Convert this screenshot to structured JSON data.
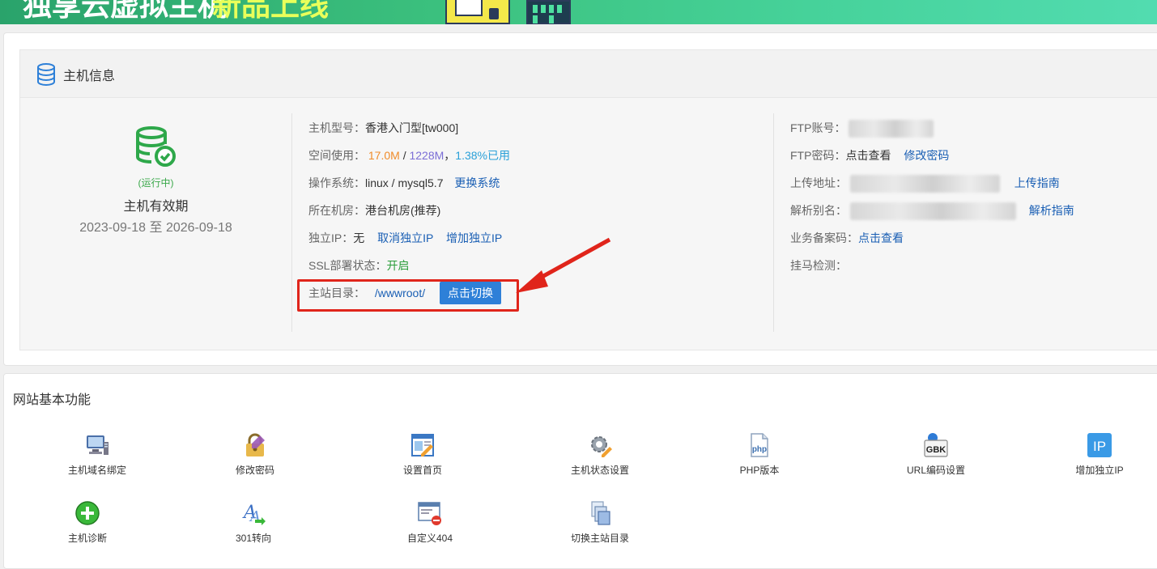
{
  "banner": {
    "title_part1": "独享云虚拟主机",
    "title_part2": "新品上线"
  },
  "host_info": {
    "title": "主机信息",
    "status": "(运行中)",
    "validity_label": "主机有效期",
    "validity_range": "2023-09-18 至 2026-09-18",
    "model_label": "主机型号：",
    "model_value": "香港入门型[tw000]",
    "space_label": "空间使用：",
    "space_used": "17.0M",
    "space_sep": " / ",
    "space_total": "1228M",
    "space_comma": "，",
    "space_percent": "1.38%已用",
    "os_label": "操作系统：",
    "os_value": "linux / mysql5.7",
    "os_change": "更换系统",
    "room_label": "所在机房：",
    "room_value": "港台机房(推荐)",
    "ip_label": "独立IP：",
    "ip_value": "无",
    "ip_cancel": "取消独立IP",
    "ip_add": "增加独立IP",
    "ssl_label": "SSL部署状态：",
    "ssl_value": "开启",
    "root_label": "主站目录：",
    "root_value": "/wwwroot/",
    "root_switch": "点击切换",
    "ftp_account_label": "FTP账号：",
    "ftp_pwd_label": "FTP密码：",
    "ftp_pwd_view": "点击查看",
    "ftp_pwd_change": "修改密码",
    "upload_label": "上传地址：",
    "upload_guide": "上传指南",
    "alias_label": "解析别名：",
    "alias_guide": "解析指南",
    "icp_label": "业务备案码：",
    "icp_view": "点击查看",
    "malware_label": "挂马检测："
  },
  "functions": {
    "title": "网站基本功能",
    "items": [
      {
        "label": "主机域名绑定",
        "icon": "computer-icon"
      },
      {
        "label": "修改密码",
        "icon": "lock-pencil-icon"
      },
      {
        "label": "设置首页",
        "icon": "page-edit-icon"
      },
      {
        "label": "主机状态设置",
        "icon": "gear-icon"
      },
      {
        "label": "PHP版本",
        "icon": "php-file-icon"
      },
      {
        "label": "URL编码设置",
        "icon": "gbk-icon"
      },
      {
        "label": "增加独立IP",
        "icon": "ip-icon"
      },
      {
        "label": "主机诊断",
        "icon": "plus-circle-icon"
      },
      {
        "label": "301转向",
        "icon": "redirect-icon"
      },
      {
        "label": "自定义404",
        "icon": "custom-404-icon"
      },
      {
        "label": "切换主站目录",
        "icon": "folder-switch-icon"
      }
    ]
  },
  "colors": {
    "accent": "#2e80d8",
    "link": "#1a5fb4",
    "highlight_box": "#e0251b",
    "running": "#3aa84a"
  }
}
